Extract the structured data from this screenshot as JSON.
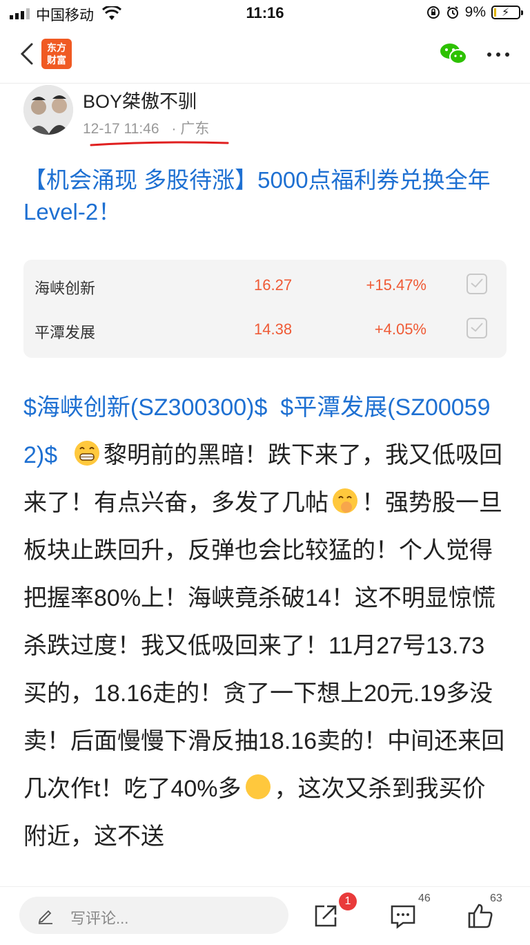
{
  "status_bar": {
    "carrier": "中国移动",
    "time": "11:16",
    "battery": "9%"
  },
  "nav": {
    "logo_line1": "东方",
    "logo_line2": "财富",
    "icons": [
      "back-icon",
      "wechat-icon",
      "more-icon"
    ]
  },
  "post": {
    "author": "BOY桀傲不驯",
    "date": "12-17 11:46",
    "location": "· 广东",
    "title": "【机会涌现 多股待涨】5000点福利券兑换全年Level-2！",
    "stocks": [
      {
        "name": "海峡创新",
        "price": "16.27",
        "change": "+15.47%"
      },
      {
        "name": "平潭发展",
        "price": "14.38",
        "change": "+4.05%"
      }
    ],
    "body": {
      "link1": "$海峡创新(SZ300300)$",
      "link2": "$平潭发展(SZ000592)$",
      "text1": "黎明前的黑暗！跌下来了，我又低吸回来了！有点兴奋，多发了几帖",
      "text2": "！强势股一旦板块止跌回升，反弹也会比较猛的！个人觉得把握率80%上！海峡竟杀破14！这不明显惊慌杀跌过度！我又低吸回来了！11月27号13.73买的，18.16走的！贪了一下想上20元.19多没卖！后面慢慢下滑反抽18.16卖的！中间还来回几次作t！吃了40%多",
      "text3": "，这次又杀到我买价附近，这不送"
    }
  },
  "bottom_bar": {
    "comment_placeholder": "写评论...",
    "share_badge": "1",
    "comment_count": "46",
    "like_count": "63"
  },
  "colors": {
    "link_blue": "#1e70d2",
    "price_red": "#ef5a35",
    "brand_orange": "#f05a23",
    "badge_red": "#e93a3a",
    "underline_red": "#e02020"
  }
}
